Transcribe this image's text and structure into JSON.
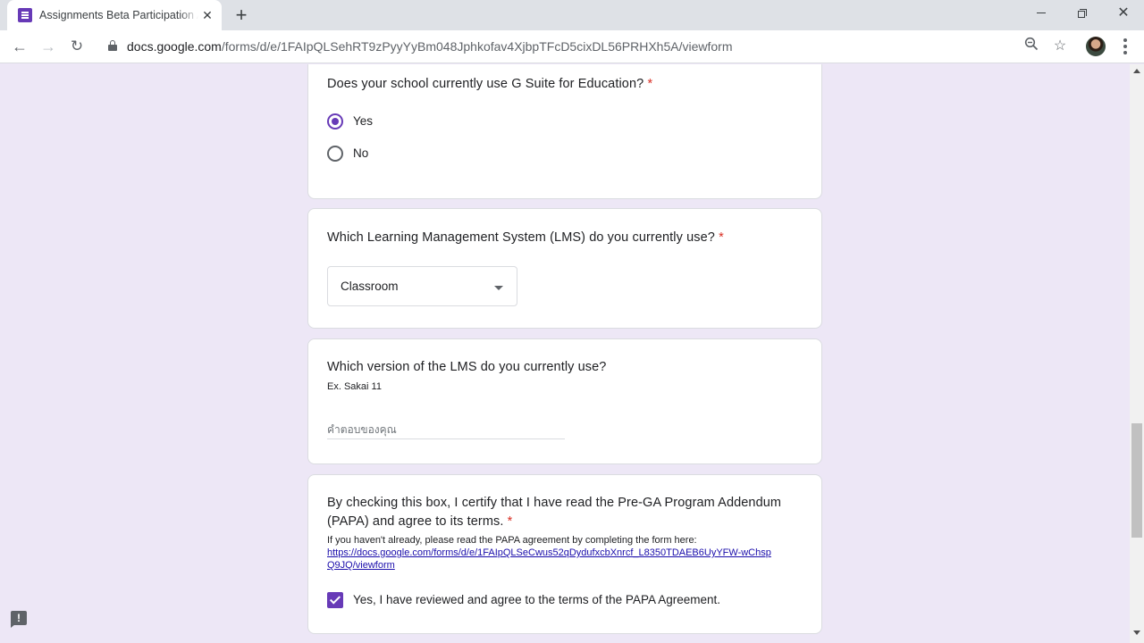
{
  "browser": {
    "tab_title": "Assignments Beta Participation Agreement",
    "tab_close": "✕",
    "new_tab": "+",
    "url_host": "docs.google.com",
    "url_path": "/forms/d/e/1FAIpQLSehRT9zPyyYyBm048Jphkofav4XjbpTFcD5cixDL56PRHXh5A/viewform",
    "icons": [
      "forms-icon",
      "back-arrow-icon",
      "forward-arrow-icon",
      "reload-icon",
      "lock-icon",
      "zoom-icon",
      "star-icon",
      "avatar",
      "menu-icon"
    ]
  },
  "questions": {
    "gsuite": {
      "title": "Does your school currently use G Suite for Education?",
      "required": "*",
      "options": [
        {
          "label": "Yes",
          "selected": true
        },
        {
          "label": "No",
          "selected": false
        }
      ]
    },
    "lms": {
      "title": "Which Learning Management System (LMS) do you currently use?",
      "required": "*",
      "selected_value": "Classroom"
    },
    "version": {
      "title": "Which version of the LMS do you currently use?",
      "helper": "Ex. Sakai 11",
      "placeholder": "คำตอบของคุณ",
      "value": ""
    },
    "papa": {
      "title": "By checking this box, I certify that I have read the Pre-GA Program Addendum (PAPA) and agree to its terms.",
      "required": "*",
      "helper": "If you haven't already, please read the PAPA agreement by completing the form here:",
      "link": "https://docs.google.com/forms/d/e/1FAIpQLSeCwus52qDydufxcbXnrcf_L8350TDAEB6UyYFW-wChspQ9JQ/viewform",
      "checkbox_label": "Yes, I have reviewed and agree to the terms of the PAPA Agreement.",
      "checked": true
    }
  },
  "feedback_button": "!",
  "colors": {
    "accent": "#673ab7",
    "page_background": "#ede7f6",
    "required": "#d93025",
    "link": "#1a0dab"
  }
}
